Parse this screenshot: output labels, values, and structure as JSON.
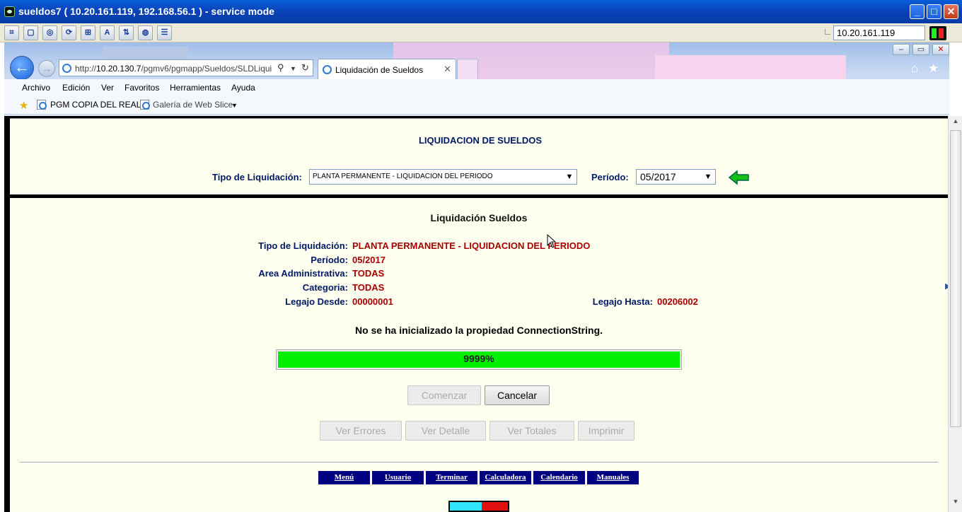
{
  "vnc": {
    "title": "sueldos7 ( 10.20.161.119, 192.168.56.1 ) - service mode",
    "ip": "10.20.161.119",
    "toolbar_icons": [
      "connection-options-icon",
      "fullscreen-icon",
      "refresh-icon",
      "reconnect-icon",
      "send-keys-icon",
      "abc-icon",
      "file-transfer-icon",
      "chat-icon",
      "settings-icon"
    ]
  },
  "browser": {
    "url_prefix": "http://",
    "url_host": "10.20.130.7",
    "url_path": "/pgmv6/pgmapp/Sueldos/SLDLiqui",
    "tab_title": "Liquidación de Sueldos",
    "menu": [
      "Archivo",
      "Edición",
      "Ver",
      "Favoritos",
      "Herramientas",
      "Ayuda"
    ],
    "favorites": {
      "item1": "PGM COPIA DEL REAL",
      "item2": "Galería de Web Slice"
    }
  },
  "form": {
    "title": "LIQUIDACION DE SUELDOS",
    "tipo_label": "Tipo de Liquidación:",
    "tipo_value": "PLANTA PERMANENTE - LIQUIDACION DEL PERIODO",
    "periodo_label": "Período:",
    "periodo_value": "05/2017"
  },
  "summary": {
    "heading": "Liquidación Sueldos",
    "rows": [
      {
        "label": "Tipo de Liquidación:",
        "value": "PLANTA PERMANENTE - LIQUIDACION DEL PERIODO"
      },
      {
        "label": "Período:",
        "value": "05/2017"
      },
      {
        "label": "Area Administrativa:",
        "value": "TODAS"
      },
      {
        "label": "Categoria:",
        "value": "TODAS"
      },
      {
        "label": "Legajo Desde:",
        "value": "00000001"
      }
    ],
    "legajo_hasta_label": "Legajo Hasta:",
    "legajo_hasta_value": "00206002",
    "message": "No se ha inicializado la propiedad ConnectionString.",
    "progress_text": "9999%",
    "progress_fraction": 1.0
  },
  "buttons": {
    "comenzar": "Comenzar",
    "cancelar": "Cancelar",
    "ver_errores": "Ver Errores",
    "ver_detalle": "Ver Detalle",
    "ver_totales": "Ver Totales",
    "imprimir": "Imprimir"
  },
  "footer_links": [
    "Menú",
    "Usuario",
    "Terminar",
    "Calculadora",
    "Calendario",
    "Manuales"
  ],
  "colors": {
    "label_blue": "#001a66",
    "value_red": "#a80000",
    "progress_green": "#00f000",
    "link_bg": "#000080",
    "page_bg": "#fffff0"
  }
}
